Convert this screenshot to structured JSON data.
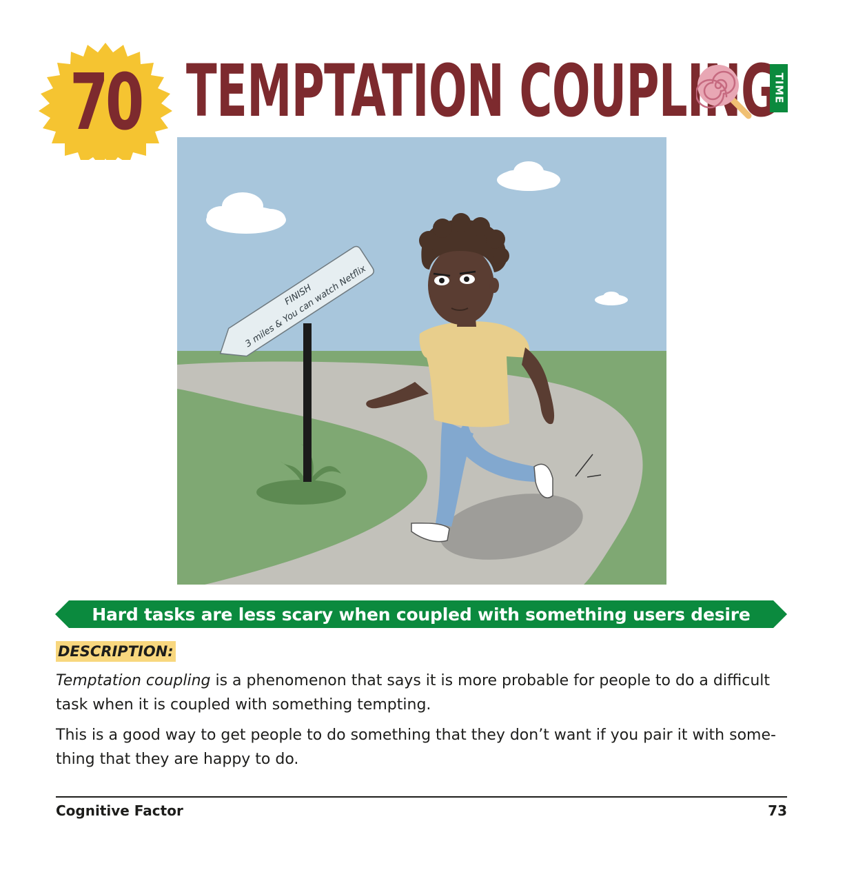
{
  "header": {
    "number": "70",
    "title": "TEMPTATION COUPLING",
    "category_tag": "TIME",
    "icon": "lollipop-icon"
  },
  "illustration": {
    "sign_line1": "FINISH",
    "sign_line2": "3 miles & You can watch Netflix"
  },
  "banner": {
    "text": "Hard tasks are less scary when coupled with something users desire"
  },
  "description": {
    "label": "DESCRIPTION:",
    "para1_term": "Temptation coupling",
    "para1_rest": " is a phenomenon that says it is more probable for people to do a difficult task when it is coupled with something tempting.",
    "para2": "This is a good way to get people to do something that they don’t want if you pair it with some-thing that they are happy to do."
  },
  "footer": {
    "section": "Cognitive Factor",
    "page": "73"
  },
  "colors": {
    "title": "#7d2a2e",
    "badge": "#f5c431",
    "banner": "#0b8a3e",
    "highlight": "#f8d77e"
  }
}
